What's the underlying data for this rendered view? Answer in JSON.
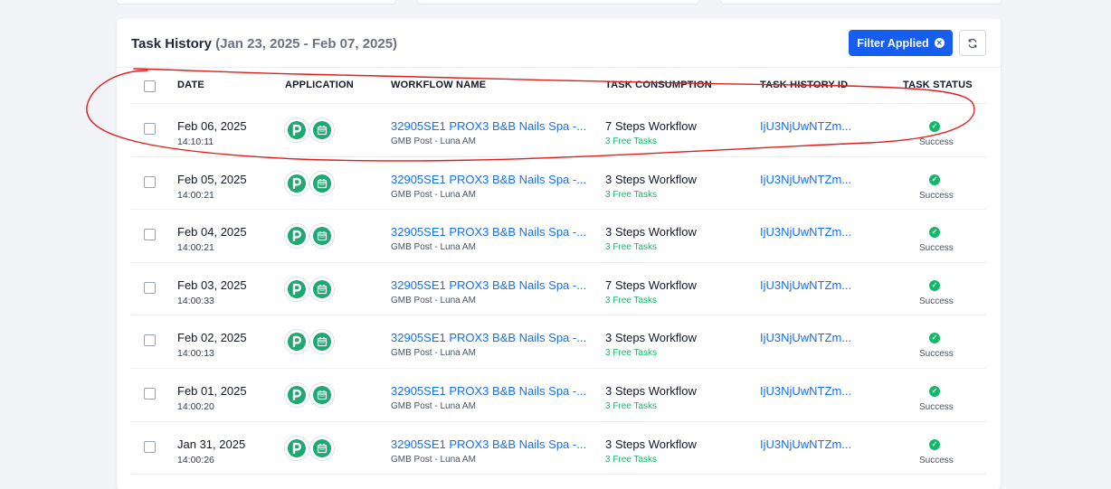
{
  "panel": {
    "title": "Task History",
    "date_range": "(Jan 23, 2025 - Feb 07, 2025)",
    "filter_button_label": "Filter Applied",
    "refresh_button_icon": "refresh-icon"
  },
  "table": {
    "columns": {
      "date": "DATE",
      "application": "APPLICATION",
      "workflow_name": "WORKFLOW NAME",
      "task_consumption": "TASK CONSUMPTION",
      "task_history_id": "TASK HISTORY ID",
      "task_status": "TASK STATUS"
    },
    "rows": [
      {
        "date": "Feb 06, 2025",
        "time": "14:10:11",
        "workflow": "32905SE1 PROX3 B&B Nails Spa -...",
        "workflow_sub": "GMB Post - Luna AM",
        "consumption": "7 Steps Workflow",
        "free_tasks": "3 Free Tasks",
        "history_id": "IjU3NjUwNTZm...",
        "status": "Success"
      },
      {
        "date": "Feb 05, 2025",
        "time": "14:00:21",
        "workflow": "32905SE1 PROX3 B&B Nails Spa -...",
        "workflow_sub": "GMB Post - Luna AM",
        "consumption": "3 Steps Workflow",
        "free_tasks": "3 Free Tasks",
        "history_id": "IjU3NjUwNTZm...",
        "status": "Success"
      },
      {
        "date": "Feb 04, 2025",
        "time": "14:00:21",
        "workflow": "32905SE1 PROX3 B&B Nails Spa -...",
        "workflow_sub": "GMB Post - Luna AM",
        "consumption": "3 Steps Workflow",
        "free_tasks": "3 Free Tasks",
        "history_id": "IjU3NjUwNTZm...",
        "status": "Success"
      },
      {
        "date": "Feb 03, 2025",
        "time": "14:00:33",
        "workflow": "32905SE1 PROX3 B&B Nails Spa -...",
        "workflow_sub": "GMB Post - Luna AM",
        "consumption": "7 Steps Workflow",
        "free_tasks": "3 Free Tasks",
        "history_id": "IjU3NjUwNTZm...",
        "status": "Success"
      },
      {
        "date": "Feb 02, 2025",
        "time": "14:00:13",
        "workflow": "32905SE1 PROX3 B&B Nails Spa -...",
        "workflow_sub": "GMB Post - Luna AM",
        "consumption": "3 Steps Workflow",
        "free_tasks": "3 Free Tasks",
        "history_id": "IjU3NjUwNTZm...",
        "status": "Success"
      },
      {
        "date": "Feb 01, 2025",
        "time": "14:00:20",
        "workflow": "32905SE1 PROX3 B&B Nails Spa -...",
        "workflow_sub": "GMB Post - Luna AM",
        "consumption": "3 Steps Workflow",
        "free_tasks": "3 Free Tasks",
        "history_id": "IjU3NjUwNTZm...",
        "status": "Success"
      },
      {
        "date": "Jan 31, 2025",
        "time": "14:00:26",
        "workflow": "32905SE1 PROX3 B&B Nails Spa -...",
        "workflow_sub": "GMB Post - Luna AM",
        "consumption": "3 Steps Workflow",
        "free_tasks": "3 Free Tasks",
        "history_id": "IjU3NjUwNTZm...",
        "status": "Success"
      }
    ]
  },
  "icons": {
    "app_1": "pabbly-p-icon",
    "app_2": "calendar-schedule-icon",
    "status": "check-circle-icon"
  },
  "colors": {
    "accent": "#155eef",
    "link": "#1570ef",
    "success": "#12b76a",
    "app_icon": "#20a873",
    "annotation": "#e11d1d"
  }
}
